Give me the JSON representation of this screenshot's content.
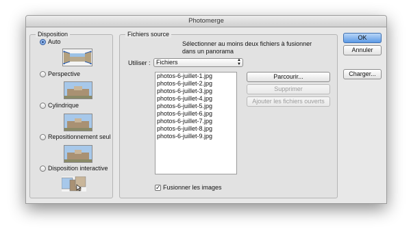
{
  "window": {
    "title": "Photomerge"
  },
  "disposition": {
    "title": "Disposition",
    "selected": "Auto",
    "options": [
      {
        "label": "Auto",
        "icon": "auto-layout-icon"
      },
      {
        "label": "Perspective",
        "icon": "perspective-layout-icon"
      },
      {
        "label": "Cylindrique",
        "icon": "cylindrical-layout-icon"
      },
      {
        "label": "Repositionnement seul",
        "icon": "reposition-layout-icon"
      },
      {
        "label": "Disposition interactive",
        "icon": "interactive-layout-icon"
      }
    ]
  },
  "source": {
    "title": "Fichiers source",
    "instruction_line1": "Sélectionner au moins deux fichiers à fusionner",
    "instruction_line2": "dans un panorama",
    "use_label": "Utiliser :",
    "use_value": "Fichiers",
    "files": [
      "photos-6-juillet-1.jpg",
      "photos-6-juillet-2.jpg",
      "photos-6-juillet-3.jpg",
      "photos-6-juillet-4.jpg",
      "photos-6-juillet-5.jpg",
      "photos-6-juillet-6.jpg",
      "photos-6-juillet-7.jpg",
      "photos-6-juillet-8.jpg",
      "photos-6-juillet-9.jpg"
    ],
    "browse_label": "Parcourir...",
    "remove_label": "Supprimer",
    "add_open_label": "Ajouter les fichiers ouverts",
    "blend_label": "Fusionner les images",
    "blend_checked": true
  },
  "buttons": {
    "ok": "OK",
    "cancel": "Annuler",
    "load": "Charger..."
  },
  "colors": {
    "accent": "#5c9ae6",
    "window_bg": "#e8e8e8"
  }
}
